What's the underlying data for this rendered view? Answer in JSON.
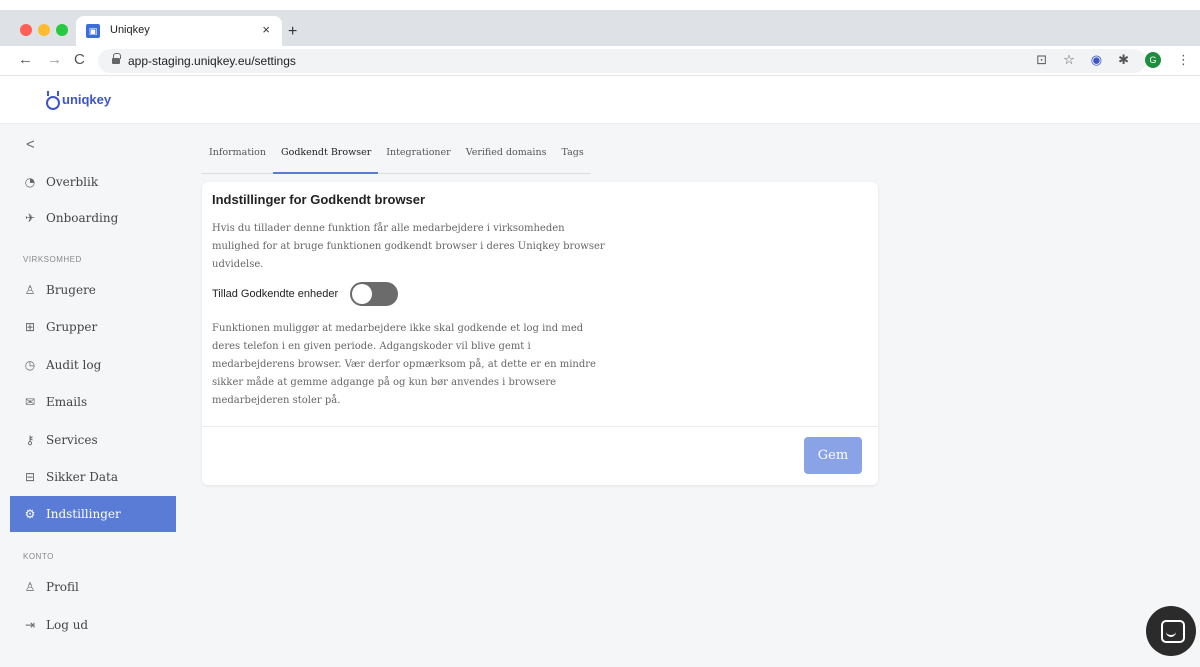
{
  "browser": {
    "tab_title": "Uniqkey",
    "tab_close": "×",
    "new_tab": "+",
    "url": "app-staging.uniqkey.eu/settings",
    "nav_back": "←",
    "nav_forward": "→",
    "nav_reload": "C",
    "avatar_letter": "G"
  },
  "app": {
    "logo_text": "uniqkey"
  },
  "sidebar": {
    "collapse": "<",
    "items_top": [
      {
        "label": "Overblik",
        "icon": "gauge-icon",
        "glyph": "◔"
      },
      {
        "label": "Onboarding",
        "icon": "rocket-icon",
        "glyph": "✈"
      }
    ],
    "section_company": "VIRKSOMHED",
    "items_company": [
      {
        "label": "Brugere",
        "icon": "users-icon",
        "glyph": "♙"
      },
      {
        "label": "Grupper",
        "icon": "groups-icon",
        "glyph": "⊞"
      },
      {
        "label": "Audit log",
        "icon": "clock-icon",
        "glyph": "◷"
      },
      {
        "label": "Emails",
        "icon": "mail-icon",
        "glyph": "✉"
      },
      {
        "label": "Services",
        "icon": "key-icon",
        "glyph": "⚷"
      },
      {
        "label": "Sikker Data",
        "icon": "briefcase-icon",
        "glyph": "⊟"
      },
      {
        "label": "Indstillinger",
        "icon": "gear-icon",
        "glyph": "⚙"
      }
    ],
    "section_account": "KONTO",
    "items_account": [
      {
        "label": "Profil",
        "icon": "user-icon",
        "glyph": "♙"
      },
      {
        "label": "Log ud",
        "icon": "logout-icon",
        "glyph": "⇥"
      }
    ],
    "active": "Indstillinger"
  },
  "main": {
    "tabs": [
      "Information",
      "Godkendt Browser",
      "Integrationer",
      "Verified domains",
      "Tags"
    ],
    "active_tab": "Godkendt Browser",
    "card": {
      "title": "Indstillinger for Godkendt browser",
      "description": "Hvis du tillader denne funktion får alle medarbejdere i virksomheden mulighed for at bruge funktionen godkendt browser i deres Uniqkey browser udvidelse.",
      "toggle_label": "Tillad Godkendte enheder",
      "toggle_on": false,
      "note": "Funktionen muliggør at medarbejdere ikke skal godkende et log ind med deres telefon i en given periode. Adgangskoder vil blive gemt i medarbejderens browser. Vær derfor opmærksom på, at dette er en mindre sikker måde at gemme adgange på og kun bør anvendes i browsere medarbejderen stoler på.",
      "save_label": "Gem"
    }
  },
  "colors": {
    "accent": "#5a7bd6",
    "save_button": "#8aa3e6",
    "brand": "#3d55c8"
  }
}
